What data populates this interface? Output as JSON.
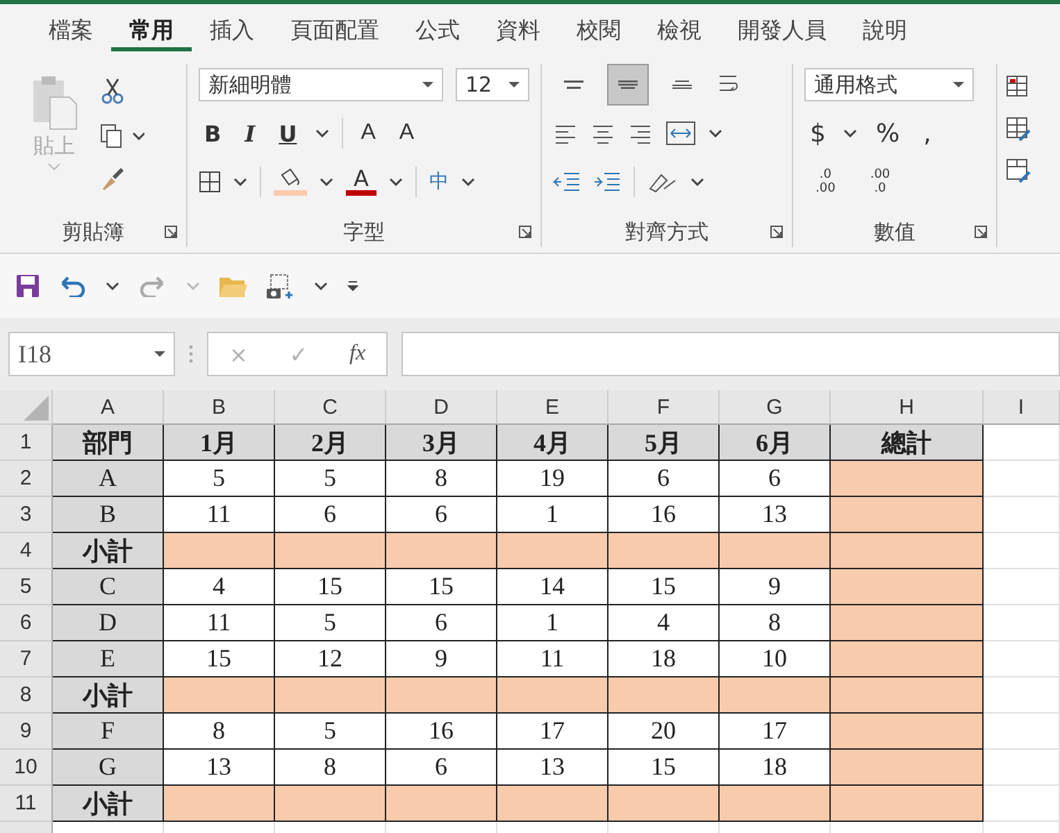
{
  "tabs": [
    {
      "label": "檔案",
      "selected": false
    },
    {
      "label": "常用",
      "selected": true
    },
    {
      "label": "插入",
      "selected": false
    },
    {
      "label": "頁面配置",
      "selected": false
    },
    {
      "label": "公式",
      "selected": false
    },
    {
      "label": "資料",
      "selected": false
    },
    {
      "label": "校閱",
      "selected": false
    },
    {
      "label": "檢視",
      "selected": false
    },
    {
      "label": "開發人員",
      "selected": false
    },
    {
      "label": "說明",
      "selected": false
    }
  ],
  "clipboard": {
    "label": "剪貼簿",
    "paste": "貼上"
  },
  "font": {
    "label": "字型",
    "font_name": "新細明體",
    "font_size": "12",
    "style_buttons": [
      "B",
      "I",
      "U"
    ],
    "grow": "A",
    "shrink": "A",
    "font_color": "A",
    "phonetic": "中"
  },
  "alignment": {
    "label": "對齊方式",
    "vertical_align": [
      {
        "kind": "top",
        "selected": false
      },
      {
        "kind": "middle",
        "selected": true
      },
      {
        "kind": "bottom",
        "selected": false
      }
    ]
  },
  "number": {
    "label": "數值",
    "format": "通用格式",
    "symbols": [
      "$",
      "%",
      ","
    ],
    "increase_decimal": [
      ".0",
      ".00"
    ],
    "decrease_decimal": [
      ".00",
      ".0"
    ]
  },
  "formula_bar": {
    "name_box": "I18",
    "cancel": "×",
    "enter": "✓",
    "fx": "fx"
  },
  "sheet": {
    "columns": [
      "A",
      "B",
      "C",
      "D",
      "E",
      "F",
      "G",
      "H",
      "I"
    ],
    "rows": [
      {
        "number": "1",
        "kind": "header",
        "cells": [
          "部門",
          "1月",
          "2月",
          "3月",
          "4月",
          "5月",
          "6月",
          "總計"
        ]
      },
      {
        "number": "2",
        "kind": "data",
        "cells": [
          "A",
          "5",
          "5",
          "8",
          "19",
          "6",
          "6"
        ]
      },
      {
        "number": "3",
        "kind": "data",
        "cells": [
          "B",
          "11",
          "6",
          "6",
          "1",
          "16",
          "13"
        ]
      },
      {
        "number": "4",
        "kind": "subtotal",
        "cells": [
          "小計"
        ]
      },
      {
        "number": "5",
        "kind": "data",
        "cells": [
          "C",
          "4",
          "15",
          "15",
          "14",
          "15",
          "9"
        ]
      },
      {
        "number": "6",
        "kind": "data",
        "cells": [
          "D",
          "11",
          "5",
          "6",
          "1",
          "4",
          "8"
        ]
      },
      {
        "number": "7",
        "kind": "data",
        "cells": [
          "E",
          "15",
          "12",
          "9",
          "11",
          "18",
          "10"
        ]
      },
      {
        "number": "8",
        "kind": "subtotal",
        "cells": [
          "小計"
        ]
      },
      {
        "number": "9",
        "kind": "data",
        "cells": [
          "F",
          "8",
          "5",
          "16",
          "17",
          "20",
          "17"
        ]
      },
      {
        "number": "10",
        "kind": "data",
        "cells": [
          "G",
          "13",
          "8",
          "6",
          "13",
          "15",
          "18"
        ]
      },
      {
        "number": "11",
        "kind": "subtotal",
        "cells": [
          "小計"
        ]
      }
    ]
  }
}
